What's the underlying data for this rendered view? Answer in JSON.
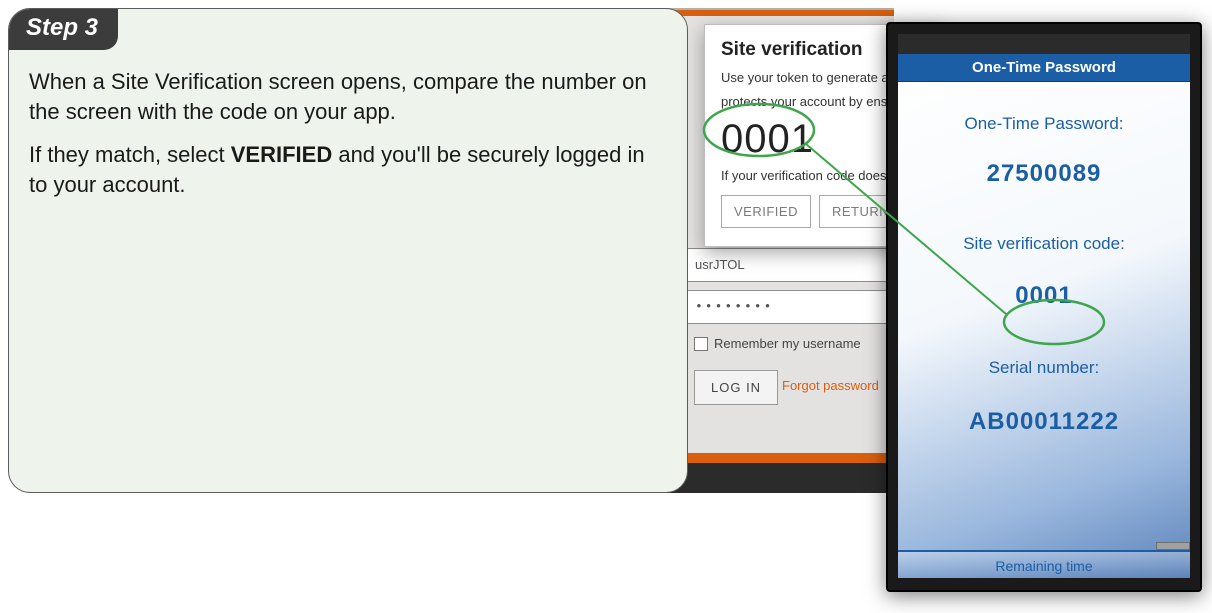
{
  "step": {
    "badge": "Step 3",
    "para1": "When a Site Verification screen opens, compare the number on the screen with the code on your app.",
    "para2_pre": "If they match, select ",
    "para2_bold": "VERIFIED",
    "para2_post": " and you'll be securely logged in to your account."
  },
  "login": {
    "username_value": "usrJTOL",
    "password_masked": "••••••••",
    "remember_label": "Remember my username",
    "login_button": "LOG IN",
    "forgot_link": "Forgot password"
  },
  "dialog": {
    "title": "Site verification",
    "desc_line1": "Use your token to generate a v",
    "desc_line2": "protects your account by ensu",
    "code": "0001",
    "note": "If your verification code does n",
    "verified_btn": "VERIFIED",
    "return_btn": "RETURN TO"
  },
  "app": {
    "header": "One-Time Password",
    "otp_label": "One-Time Password:",
    "otp_value": "27500089",
    "site_label": "Site verification code:",
    "site_value": "0001",
    "serial_label": "Serial number:",
    "serial_value": "AB00011222",
    "remaining_label": "Remaining time"
  }
}
